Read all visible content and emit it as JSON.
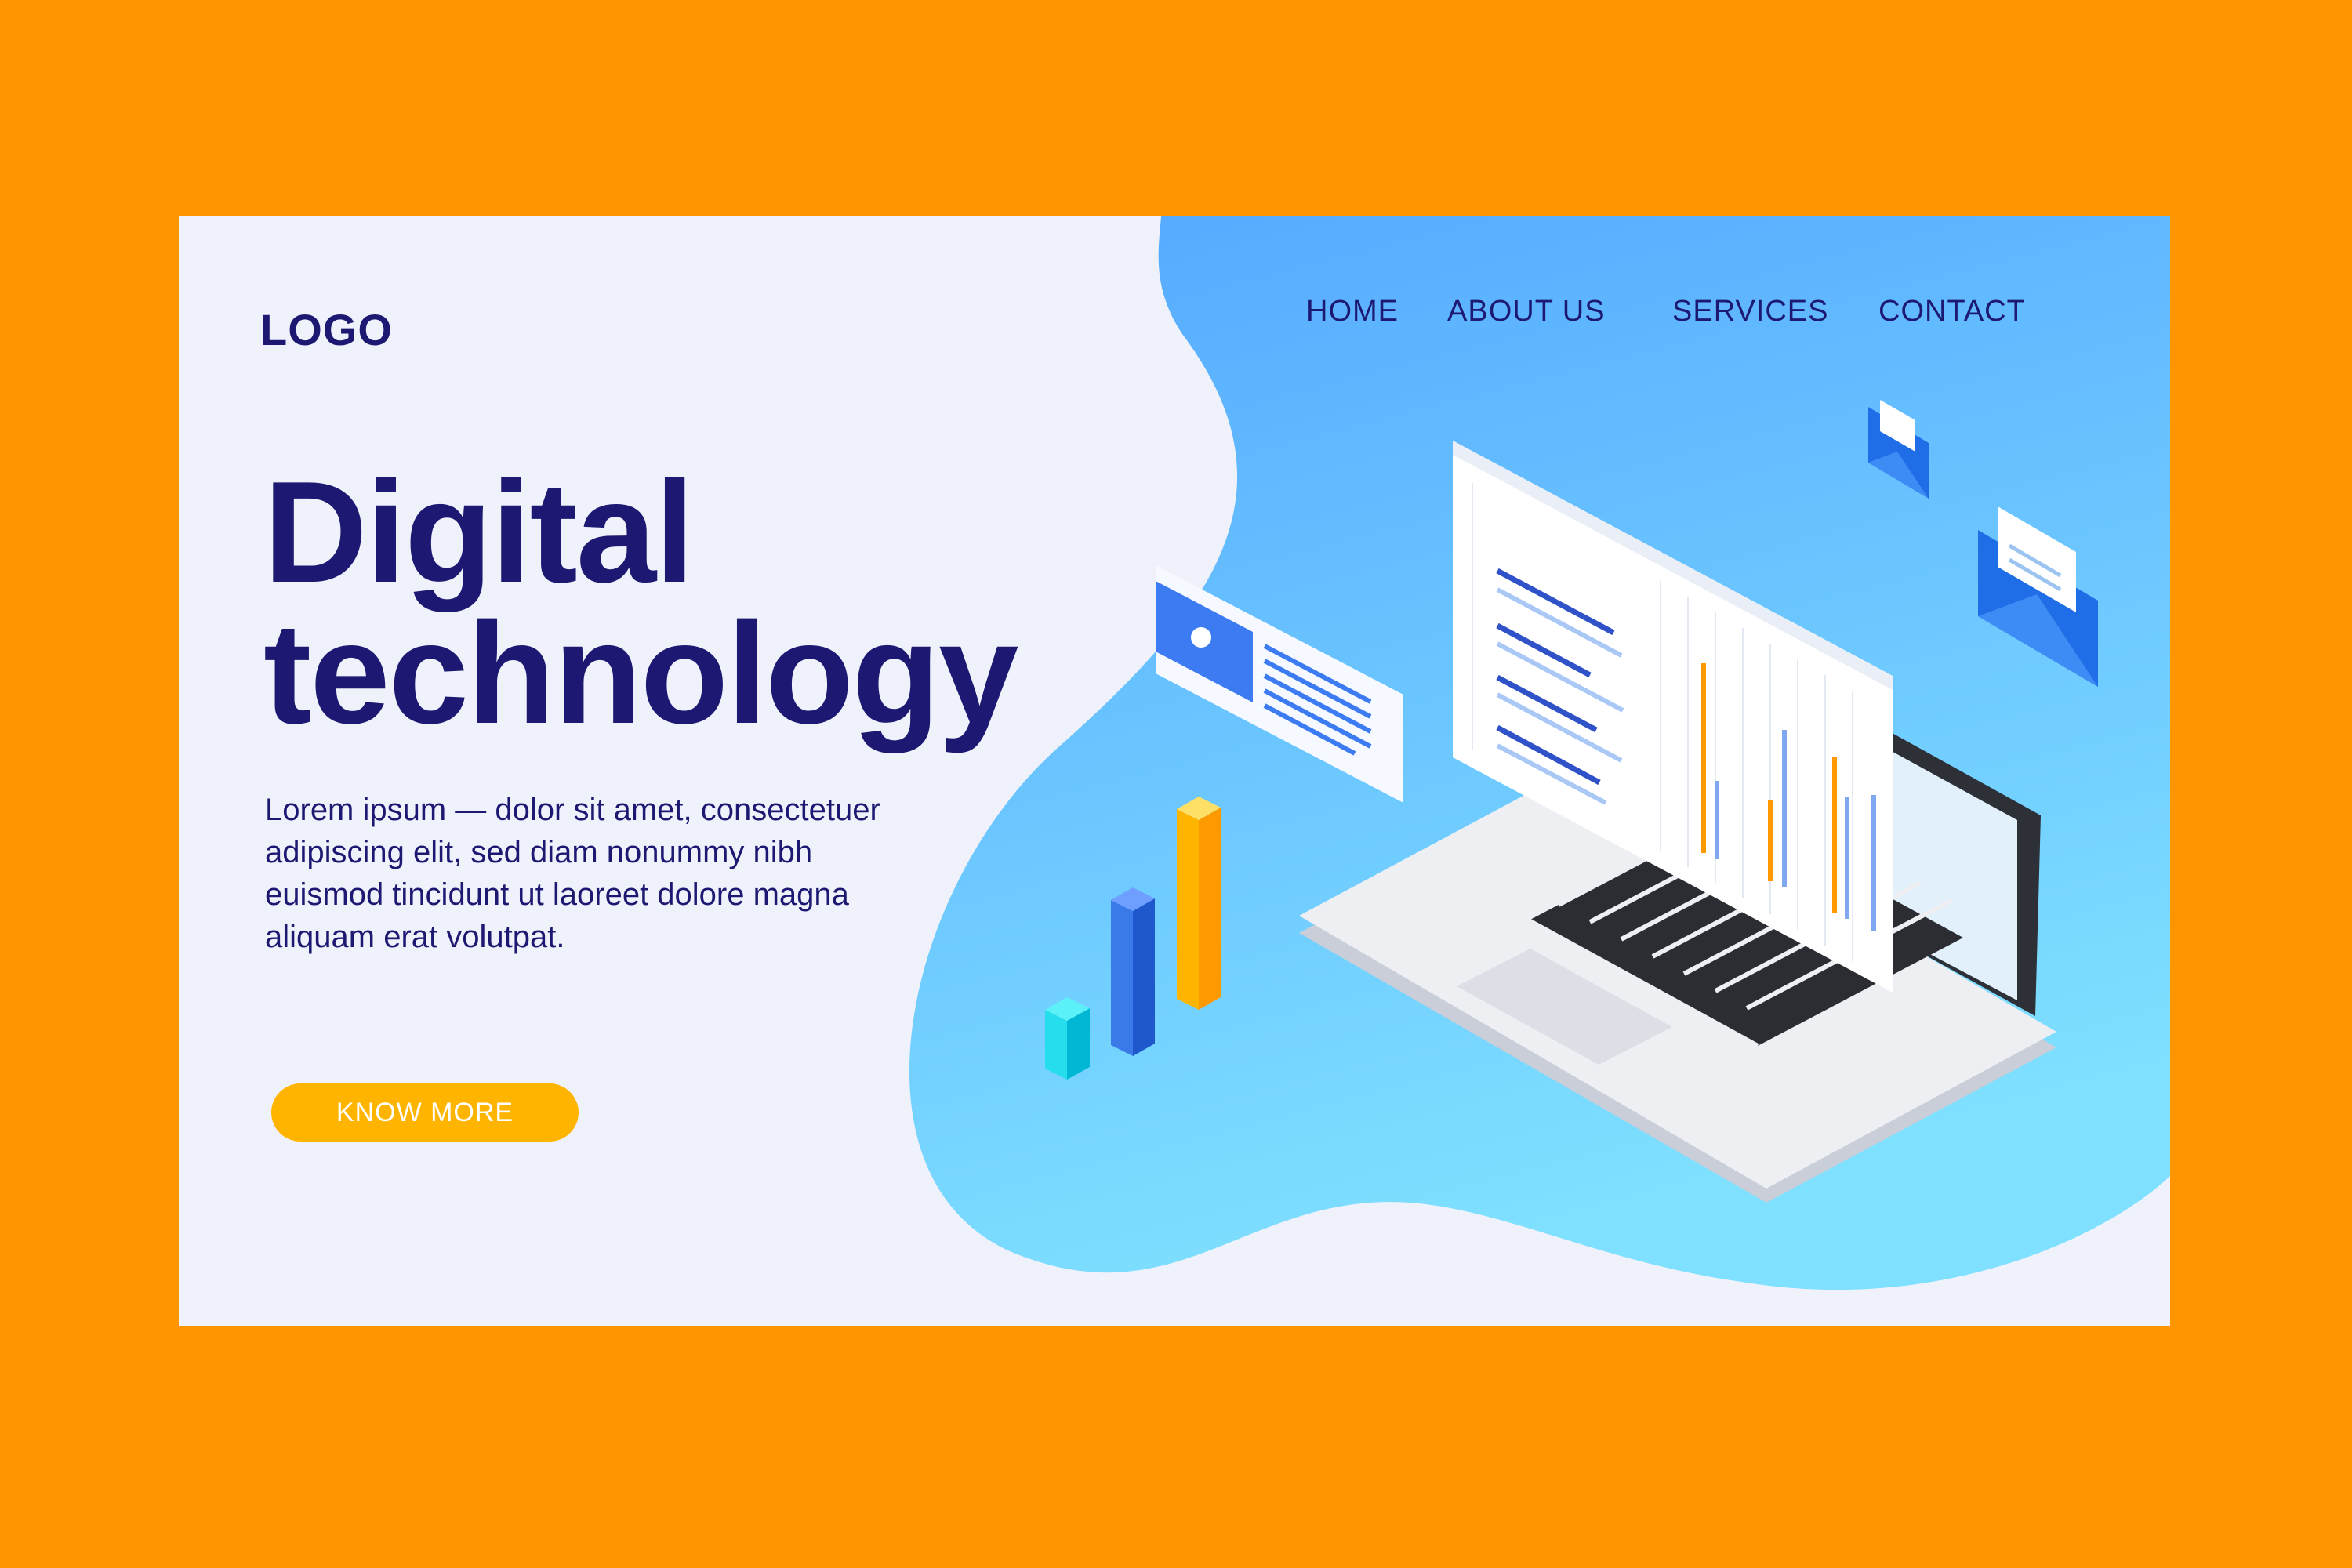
{
  "header": {
    "logo": "LOGO",
    "nav": [
      {
        "label": "HOME"
      },
      {
        "label": "ABOUT US"
      },
      {
        "label": "SERVICES"
      },
      {
        "label": "CONTACT"
      }
    ]
  },
  "hero": {
    "title_line1": "Digital",
    "title_line2": "technology",
    "body": "Lorem ipsum — dolor sit amet, consectetuer adipiscing elit, sed diam nonummy nibh euismod tincidunt ut laoreet dolore magna aliquam erat volutpat.",
    "cta_label": "KNOW MORE"
  },
  "colors": {
    "page_background": "#FF9500",
    "card_background": "#EFF2FA",
    "primary_text": "#1D1973",
    "accent_blob": "#5AAFFF",
    "cta": "#FFB400"
  },
  "icons": [
    "laptop-icon",
    "bar-chart-icon",
    "media-card-icon",
    "envelope-icon"
  ]
}
